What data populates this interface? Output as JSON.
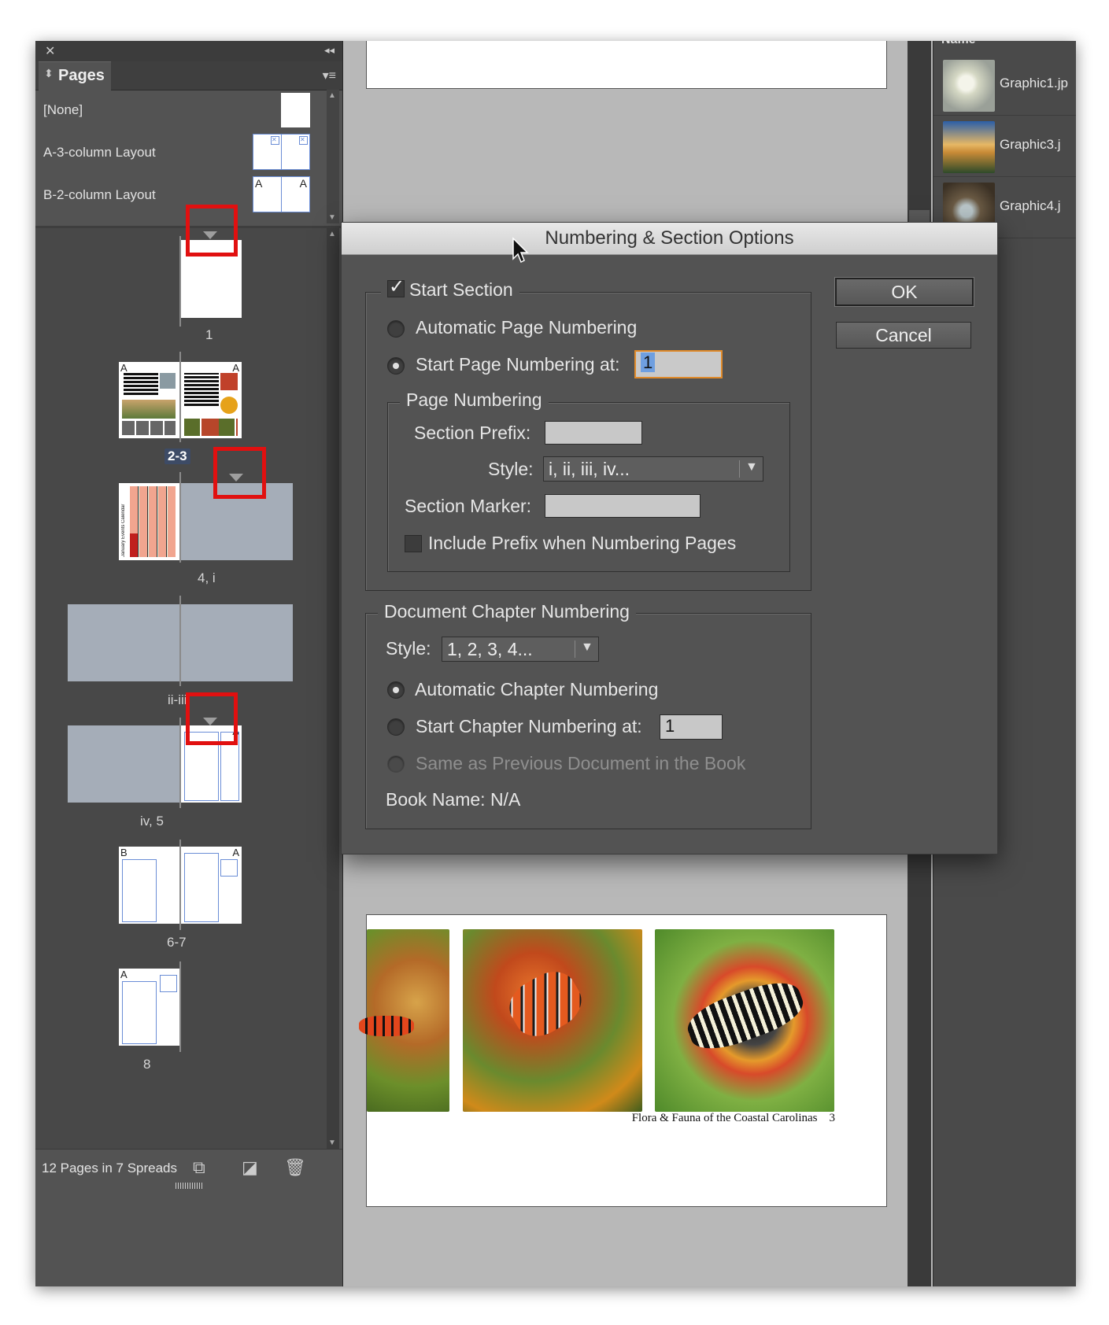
{
  "pages_panel": {
    "tab_label": "Pages",
    "masters": [
      {
        "label": "[None]"
      },
      {
        "label": "A-3-column Layout",
        "prefix": "A"
      },
      {
        "label": "B-2-column Layout",
        "prefix": "A"
      }
    ],
    "spreads": [
      {
        "label": "1"
      },
      {
        "label": "2-3",
        "selected": true,
        "left_prefix": "A",
        "right_prefix": "A"
      },
      {
        "label": "4, i"
      },
      {
        "label": "ii-iii"
      },
      {
        "label": "iv, 5",
        "right_prefix": "A"
      },
      {
        "label": "6-7",
        "left_prefix": "B",
        "right_prefix": "A"
      },
      {
        "label": "8",
        "left_prefix": "A"
      }
    ],
    "calendar_title": "January Events Calendar",
    "page2_heading": "Amazing habitat",
    "page3_heading": "Amazing migration",
    "footer_label": "12 Pages in 7 Spreads",
    "icons": [
      "close-icon",
      "collapse-icon",
      "panel-menu-icon",
      "edit-page-size-icon",
      "new-page-icon",
      "trash-icon"
    ]
  },
  "links_panel": {
    "header": "Name",
    "items": [
      {
        "name": "Graphic1.jp"
      },
      {
        "name": "Graphic3.j"
      },
      {
        "name": "Graphic4.j"
      }
    ]
  },
  "document": {
    "footer_text": "Flora & Fauna of the Coastal Carolinas",
    "page_number": "3"
  },
  "dialog": {
    "title": "Numbering & Section Options",
    "start_section": {
      "label": "Start Section",
      "checked": true
    },
    "automatic_page_numbering": {
      "label": "Automatic Page Numbering",
      "selected": false
    },
    "start_page_numbering": {
      "label": "Start Page Numbering at:",
      "selected": true,
      "value": "1"
    },
    "page_numbering_group": "Page Numbering",
    "section_prefix": {
      "label": "Section Prefix:",
      "value": ""
    },
    "style": {
      "label": "Style:",
      "value": "i, ii, iii, iv..."
    },
    "section_marker": {
      "label": "Section Marker:",
      "value": ""
    },
    "include_prefix": {
      "label": "Include Prefix when Numbering Pages",
      "checked": false
    },
    "chapter_group": "Document Chapter Numbering",
    "chapter_style": {
      "label": "Style:",
      "value": "1, 2, 3, 4..."
    },
    "automatic_chapter": {
      "label": "Automatic Chapter Numbering",
      "selected": true
    },
    "start_chapter": {
      "label": "Start Chapter Numbering at:",
      "selected": false,
      "value": "1"
    },
    "same_as_previous": {
      "label": "Same as Previous Document in the Book",
      "enabled": false
    },
    "book_name": "Book Name: N/A",
    "ok_label": "OK",
    "cancel_label": "Cancel"
  },
  "colors": {
    "panel": "#535353",
    "highlight_box": "#e11010",
    "focus_ring": "#e08a2a",
    "selection": "#6f9fe0"
  }
}
